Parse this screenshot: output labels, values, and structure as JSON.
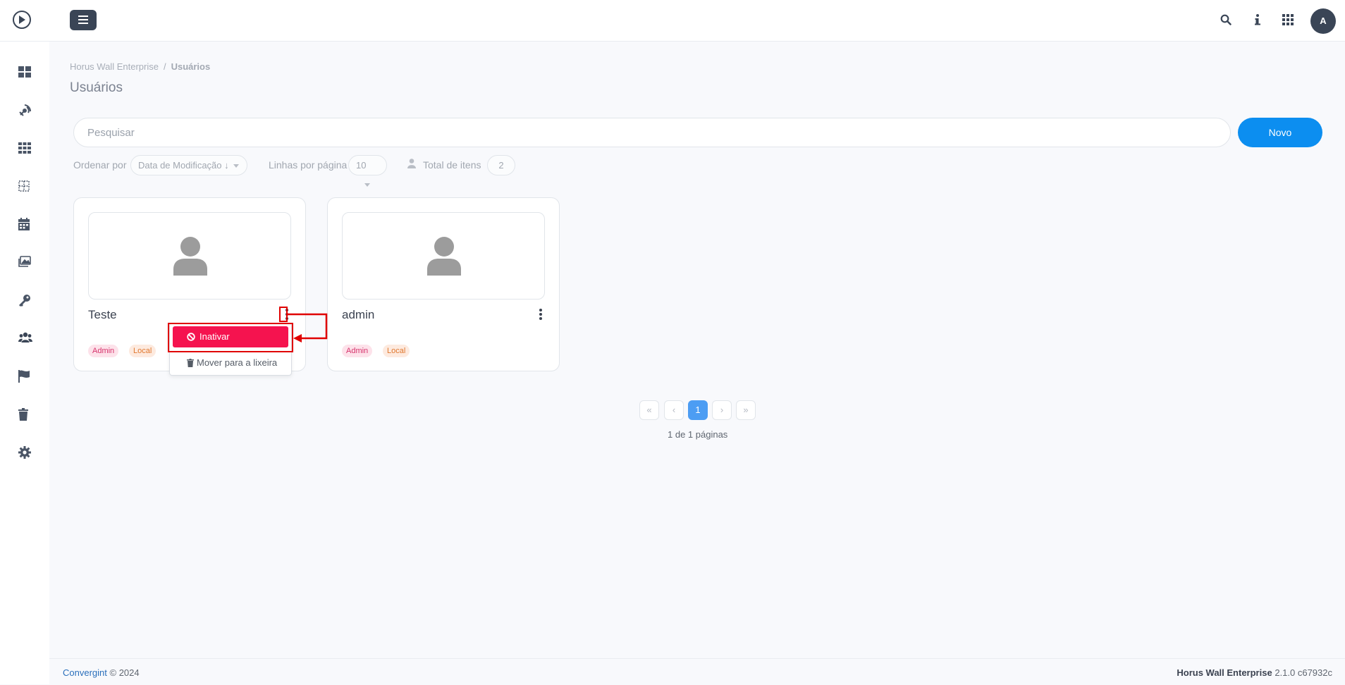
{
  "app": {
    "avatar_letter": "A"
  },
  "icons": {
    "logo": "play-circle-icon",
    "menu": "hamburger-icon",
    "top": [
      "search-icon",
      "info-icon",
      "apps-grid-icon"
    ],
    "sidebar": [
      "dashboard-icon",
      "broadcast-icon",
      "grid-icon",
      "layout-icon",
      "calendar-icon",
      "images-icon",
      "key-icon",
      "users-icon",
      "flag-icon",
      "trash-icon",
      "gear-icon"
    ]
  },
  "breadcrumb": {
    "root": "Horus Wall Enterprise",
    "separator": "/",
    "current": "Usuários"
  },
  "page": {
    "title": "Usuários"
  },
  "search": {
    "placeholder": "Pesquisar",
    "value": ""
  },
  "toolbar": {
    "new_label": "Novo",
    "order_label": "Ordenar por",
    "order_value": "Data de Modificação ↓",
    "rows_label": "Linhas por página",
    "rows_value": "10",
    "total_label": "Total de itens",
    "total_value": "2"
  },
  "users": [
    {
      "name": "Teste",
      "badges": [
        "Admin",
        "Local"
      ]
    },
    {
      "name": "admin",
      "badges": [
        "Admin",
        "Local"
      ]
    }
  ],
  "context_menu": {
    "inactivate_label": "Inativar",
    "trash_label": "Mover para a lixeira"
  },
  "pagination": {
    "first": "«",
    "prev": "‹",
    "current": "1",
    "next": "›",
    "last": "»",
    "info": "1 de 1 páginas"
  },
  "footer": {
    "company": "Convergint",
    "copyright": "© 2024",
    "product": "Horus Wall Enterprise",
    "version": "2.1.0 c67932c"
  },
  "colors": {
    "primary": "#0c8ef0",
    "danger": "#f5134f",
    "dark": "#3a4556",
    "annotation": "#e00000"
  }
}
